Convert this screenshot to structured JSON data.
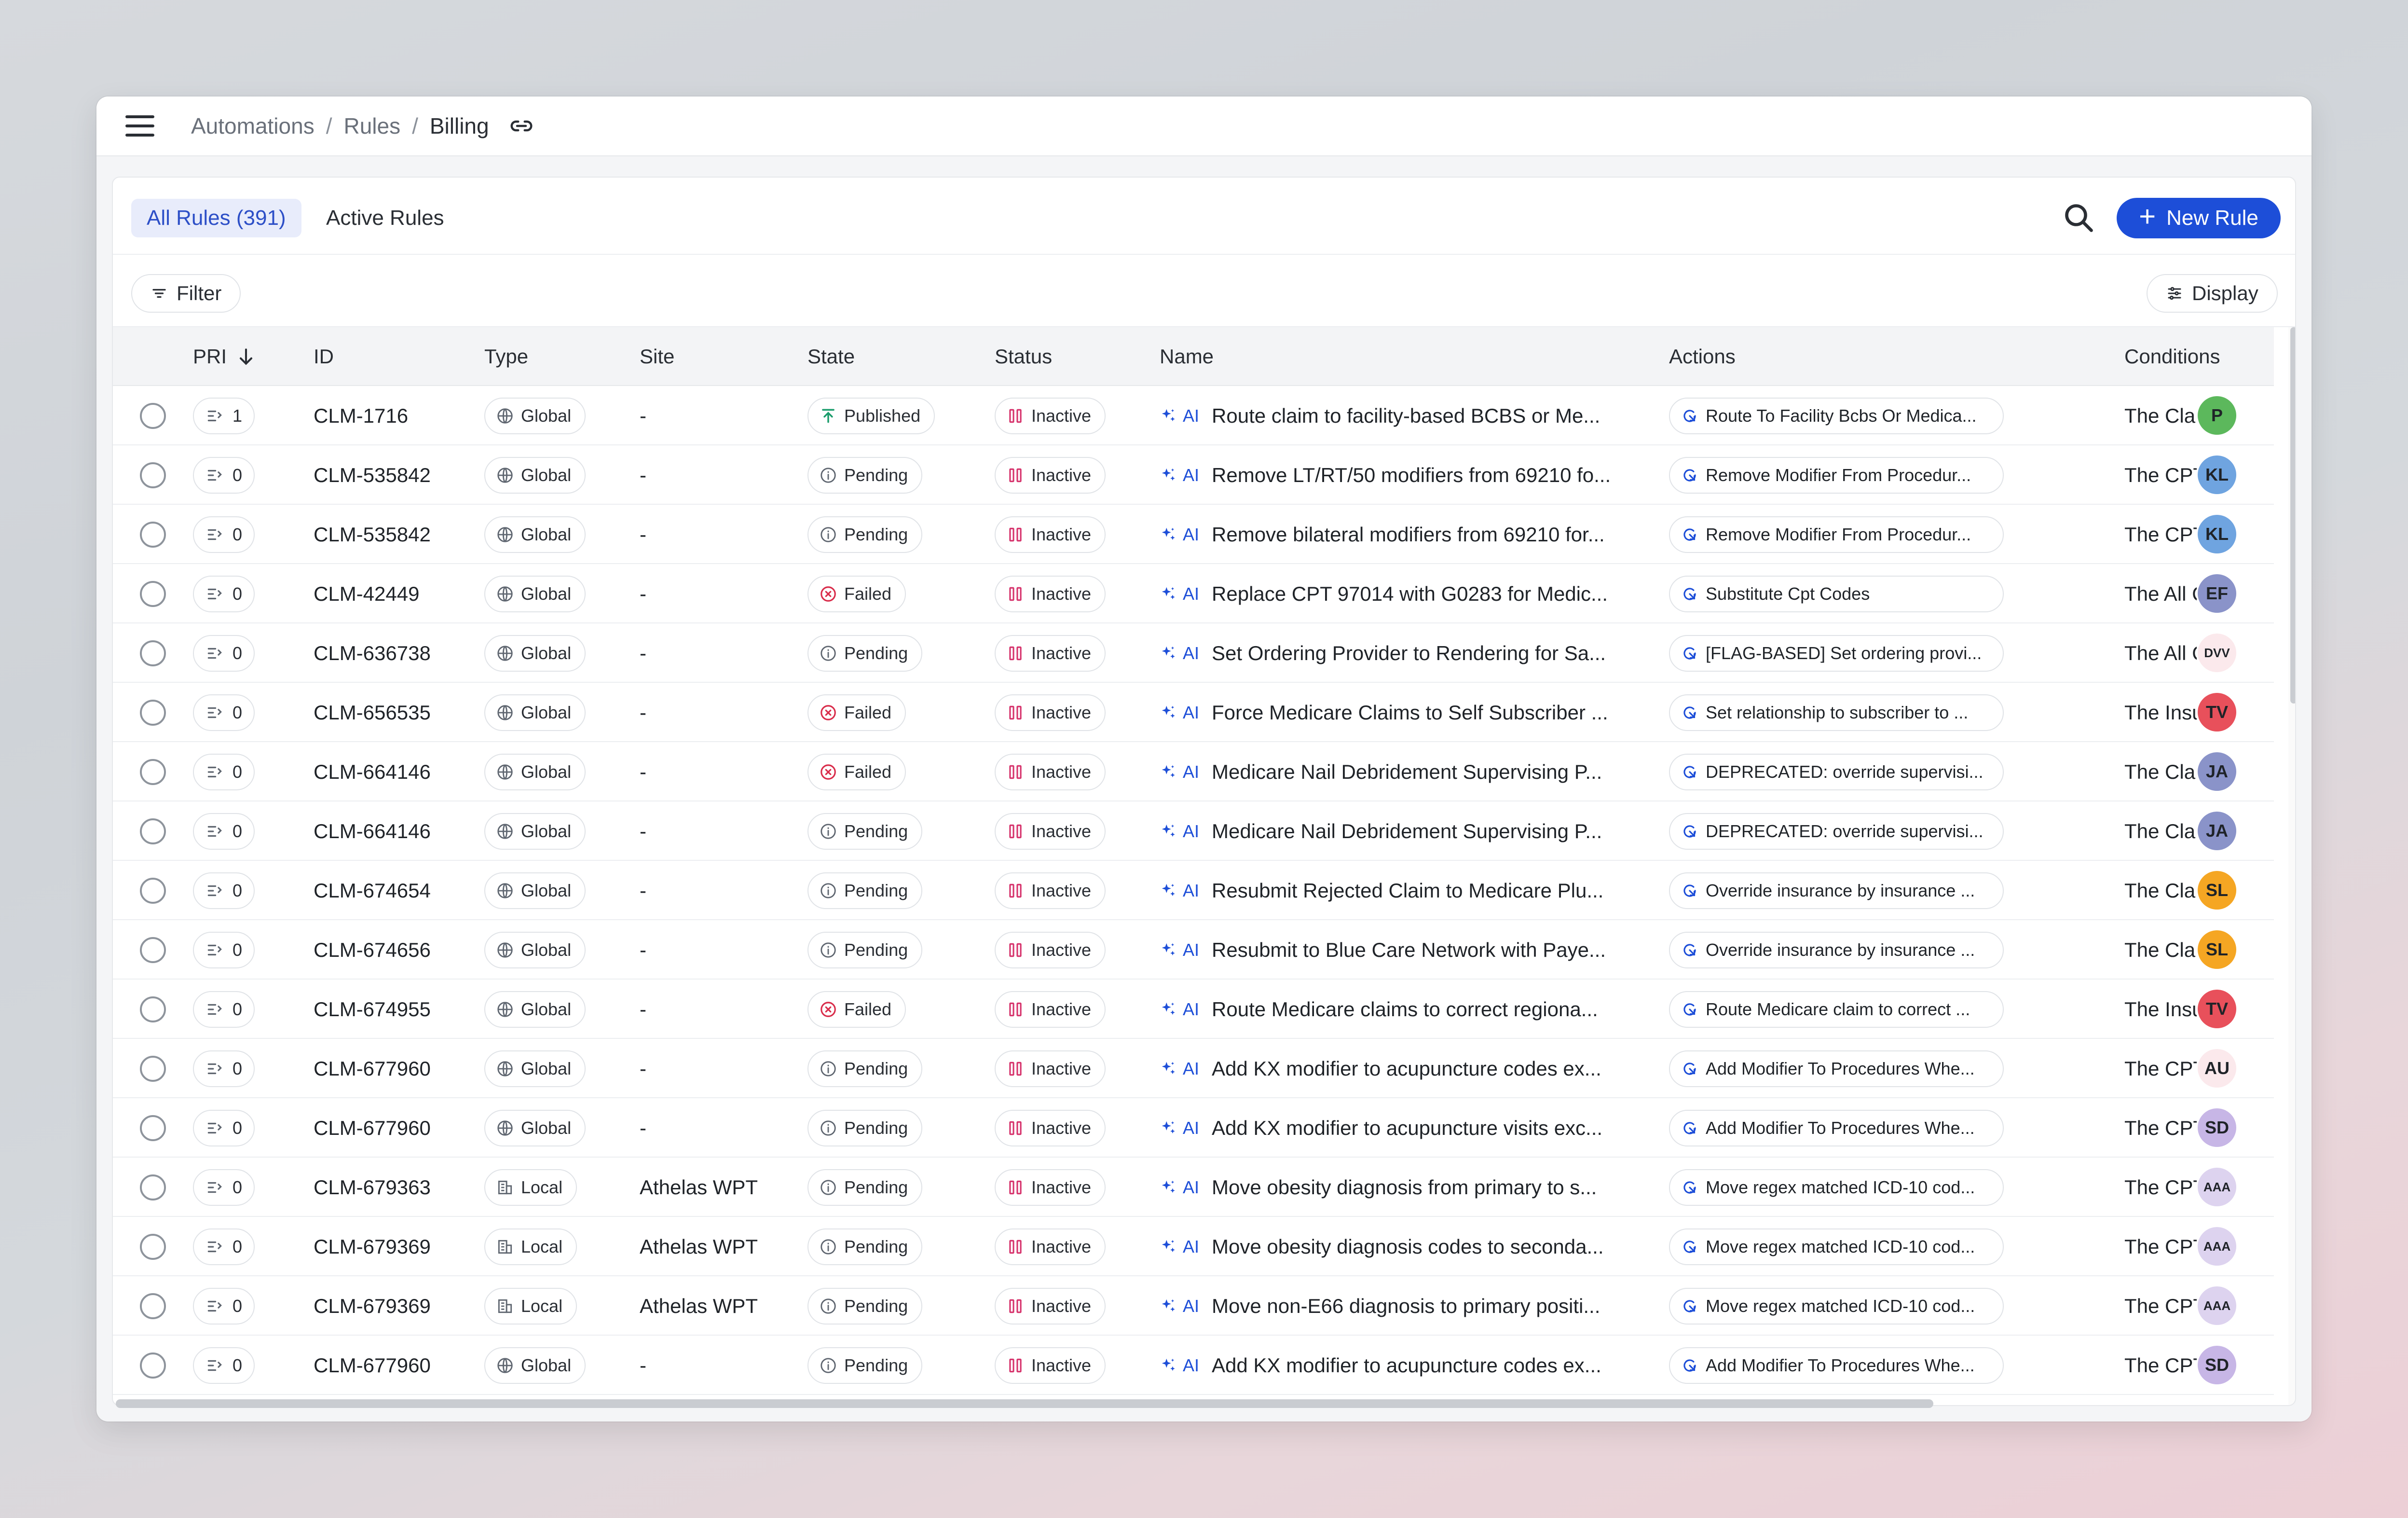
{
  "breadcrumb": [
    "Automations",
    "Rules",
    "Billing"
  ],
  "tabs": {
    "all_label": "All Rules",
    "all_count": "(391)",
    "active_label": "Active Rules"
  },
  "toolbar": {
    "new_rule_label": "New Rule",
    "filter_label": "Filter",
    "display_label": "Display"
  },
  "columns": {
    "pri": "PRI",
    "id": "ID",
    "type": "Type",
    "site": "Site",
    "state": "State",
    "status": "Status",
    "name": "Name",
    "actions": "Actions",
    "conditions": "Conditions"
  },
  "rows": [
    {
      "pri": "1",
      "id": "CLM-1716",
      "type": "Global",
      "site": "-",
      "state": "Published",
      "status": "Inactive",
      "name": "Route claim to facility-based BCBS or Me...",
      "action": "Route To Facility Bcbs Or Medica...",
      "cond": "The Cla",
      "avatar": "P",
      "avatar_color": "#5cb85c"
    },
    {
      "pri": "0",
      "id": "CLM-535842",
      "type": "Global",
      "site": "-",
      "state": "Pending",
      "status": "Inactive",
      "name": "Remove LT/RT/50 modifiers from 69210 fo...",
      "action": "Remove Modifier From Procedur...",
      "cond": "The CPT",
      "avatar": "KL",
      "avatar_color": "#6fa4e0"
    },
    {
      "pri": "0",
      "id": "CLM-535842",
      "type": "Global",
      "site": "-",
      "state": "Pending",
      "status": "Inactive",
      "name": "Remove bilateral modifiers from 69210 for...",
      "action": "Remove Modifier From Procedur...",
      "cond": "The CPT",
      "avatar": "KL",
      "avatar_color": "#6fa4e0"
    },
    {
      "pri": "0",
      "id": "CLM-42449",
      "type": "Global",
      "site": "-",
      "state": "Failed",
      "status": "Inactive",
      "name": "Replace CPT 97014 with G0283 for Medic...",
      "action": "Substitute Cpt Codes",
      "cond": "The All C",
      "avatar": "EF",
      "avatar_color": "#8a93c9"
    },
    {
      "pri": "0",
      "id": "CLM-636738",
      "type": "Global",
      "site": "-",
      "state": "Pending",
      "status": "Inactive",
      "name": "Set Ordering Provider to Rendering for Sa...",
      "action": "[FLAG-BASED] Set ordering provi...",
      "cond": "The All C",
      "avatar": "DVV",
      "avatar_color": "#fbe9ec"
    },
    {
      "pri": "0",
      "id": "CLM-656535",
      "type": "Global",
      "site": "-",
      "state": "Failed",
      "status": "Inactive",
      "name": "Force Medicare Claims to Self Subscriber ...",
      "action": "Set relationship to subscriber to ...",
      "cond": "The Insu",
      "avatar": "TV",
      "avatar_color": "#e8505b"
    },
    {
      "pri": "0",
      "id": "CLM-664146",
      "type": "Global",
      "site": "-",
      "state": "Failed",
      "status": "Inactive",
      "name": "Medicare Nail Debridement Supervising P...",
      "action": "DEPRECATED: override supervisi...",
      "cond": "The Cla",
      "avatar": "JA",
      "avatar_color": "#8a93c9"
    },
    {
      "pri": "0",
      "id": "CLM-664146",
      "type": "Global",
      "site": "-",
      "state": "Pending",
      "status": "Inactive",
      "name": "Medicare Nail Debridement Supervising P...",
      "action": "DEPRECATED: override supervisi...",
      "cond": "The Cla",
      "avatar": "JA",
      "avatar_color": "#8a93c9"
    },
    {
      "pri": "0",
      "id": "CLM-674654",
      "type": "Global",
      "site": "-",
      "state": "Pending",
      "status": "Inactive",
      "name": "Resubmit Rejected Claim to Medicare Plu...",
      "action": "Override insurance by insurance ...",
      "cond": "The Cla",
      "avatar": "SL",
      "avatar_color": "#f5a623"
    },
    {
      "pri": "0",
      "id": "CLM-674656",
      "type": "Global",
      "site": "-",
      "state": "Pending",
      "status": "Inactive",
      "name": "Resubmit to Blue Care Network with Paye...",
      "action": "Override insurance by insurance ...",
      "cond": "The Cla",
      "avatar": "SL",
      "avatar_color": "#f5a623"
    },
    {
      "pri": "0",
      "id": "CLM-674955",
      "type": "Global",
      "site": "-",
      "state": "Failed",
      "status": "Inactive",
      "name": "Route Medicare claims to correct regiona...",
      "action": "Route Medicare claim to correct ...",
      "cond": "The Insu",
      "avatar": "TV",
      "avatar_color": "#e8505b"
    },
    {
      "pri": "0",
      "id": "CLM-677960",
      "type": "Global",
      "site": "-",
      "state": "Pending",
      "status": "Inactive",
      "name": "Add KX modifier to acupuncture codes ex...",
      "action": "Add Modifier To Procedures Whe...",
      "cond": "The CPT",
      "avatar": "AU",
      "avatar_color": "#fbe9ec"
    },
    {
      "pri": "0",
      "id": "CLM-677960",
      "type": "Global",
      "site": "-",
      "state": "Pending",
      "status": "Inactive",
      "name": "Add KX modifier to acupuncture visits exc...",
      "action": "Add Modifier To Procedures Whe...",
      "cond": "The CPT",
      "avatar": "SD",
      "avatar_color": "#c7b6e6"
    },
    {
      "pri": "0",
      "id": "CLM-679363",
      "type": "Local",
      "site": "Athelas WPT",
      "state": "Pending",
      "status": "Inactive",
      "name": "Move obesity diagnosis from primary to s...",
      "action": "Move regex matched ICD-10 cod...",
      "cond": "The CPT",
      "avatar": "AAA",
      "avatar_color": "#ddd3ef"
    },
    {
      "pri": "0",
      "id": "CLM-679369",
      "type": "Local",
      "site": "Athelas WPT",
      "state": "Pending",
      "status": "Inactive",
      "name": "Move obesity diagnosis codes to seconda...",
      "action": "Move regex matched ICD-10 cod...",
      "cond": "The CPT",
      "avatar": "AAA",
      "avatar_color": "#ddd3ef"
    },
    {
      "pri": "0",
      "id": "CLM-679369",
      "type": "Local",
      "site": "Athelas WPT",
      "state": "Pending",
      "status": "Inactive",
      "name": "Move non-E66 diagnosis to primary positi...",
      "action": "Move regex matched ICD-10 cod...",
      "cond": "The CPT",
      "avatar": "AAA",
      "avatar_color": "#ddd3ef"
    },
    {
      "pri": "0",
      "id": "CLM-677960",
      "type": "Global",
      "site": "-",
      "state": "Pending",
      "status": "Inactive",
      "name": "Add KX modifier to acupuncture codes ex...",
      "action": "Add Modifier To Procedures Whe...",
      "cond": "The CPT",
      "avatar": "SD",
      "avatar_color": "#c7b6e6"
    }
  ],
  "ai_label": "AI",
  "colors": {
    "accent": "#1d4ed8",
    "published": "#1a9c6b",
    "failed": "#d92d4b",
    "pending": "#5f6670",
    "inactive": "#d6336c"
  }
}
